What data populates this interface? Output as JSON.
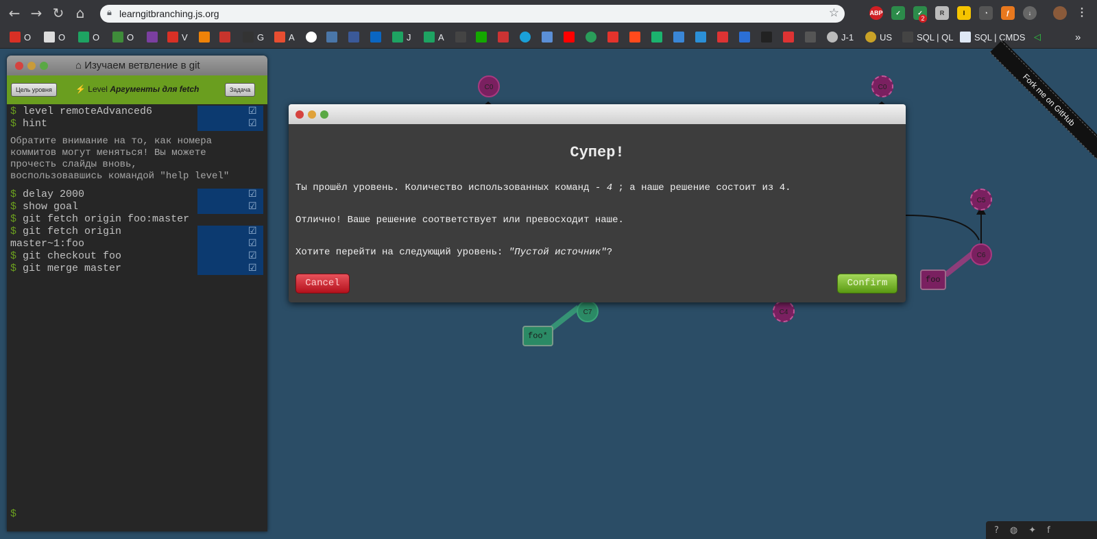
{
  "browser": {
    "url": "learngitbranching.js.org",
    "bookmarks": [
      "O",
      "O",
      "O",
      "O",
      "V",
      "G",
      "A",
      "J",
      "A",
      "J-1",
      "US",
      "SQL | QL",
      "SQL | CMDS"
    ],
    "ext_badge": "2",
    "ext_abp": "ABP",
    "more": "»"
  },
  "terminal": {
    "title": "Изучаем ветвление в git",
    "goal_button": "Цель уровня",
    "level_prefix": "Level",
    "level_name": "Аргументы для fetch",
    "task_button": "Задача",
    "lines": [
      "level remoteAdvanced6",
      "hint",
      "delay 2000",
      "show goal",
      "git fetch origin foo:master",
      "git fetch origin",
      "master~1:foo",
      "git checkout foo",
      "git merge master"
    ],
    "hint_text": [
      "Обратите внимание на то, как номера",
      "коммитов могут меняться! Вы можете",
      "прочесть слайды вновь,",
      "воспользовавшись командой \"help level\""
    ],
    "prompt": "$"
  },
  "graph": {
    "commits": [
      "C0",
      "C0",
      "C5",
      "C6",
      "C7",
      "C4"
    ],
    "branches": [
      "foo*",
      "foo"
    ]
  },
  "modal": {
    "heading": "Супер!",
    "line1_a": "Ты прошёл уровень. Количество использованных команд - ",
    "line1_count": "4",
    "line1_b": " ; а наше решение состоит из 4.",
    "line2": "Отлично! Ваше решение соответствует или превосходит наше.",
    "line3_a": "Хотите перейти на следующий уровень: ",
    "line3_level": "\"Пустой источник\"",
    "line3_b": "?",
    "cancel": "Cancel",
    "confirm": "Confirm"
  },
  "ribbon": "Fork me on GitHub",
  "colors": {
    "background": "#2b4d66",
    "terminal_green": "#6a9e1f",
    "commit_purple": "#7a2060",
    "commit_green": "#2b8a65"
  }
}
